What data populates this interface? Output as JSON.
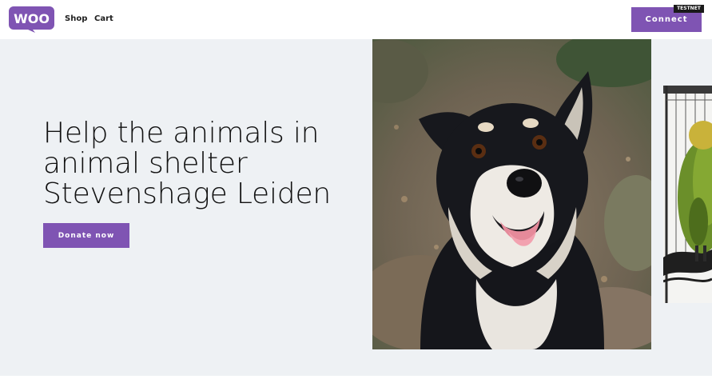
{
  "header": {
    "logo_text": "WOO",
    "nav": [
      {
        "label": "Shop"
      },
      {
        "label": "Cart"
      }
    ],
    "connect_label": "Connect",
    "badge": "TESTNET"
  },
  "hero": {
    "headline_lines": [
      "Help the animals in",
      "animal shelter",
      "Stevenshage Leiden"
    ],
    "donate_label": "Donate now"
  },
  "colors": {
    "brand": "#7f54b3",
    "hero_background": "#eef1f4",
    "text": "#111111"
  },
  "images": [
    {
      "name": "dog-photo",
      "subject": "black and white dog"
    },
    {
      "name": "parrot-photo",
      "subject": "green parrot"
    }
  ]
}
